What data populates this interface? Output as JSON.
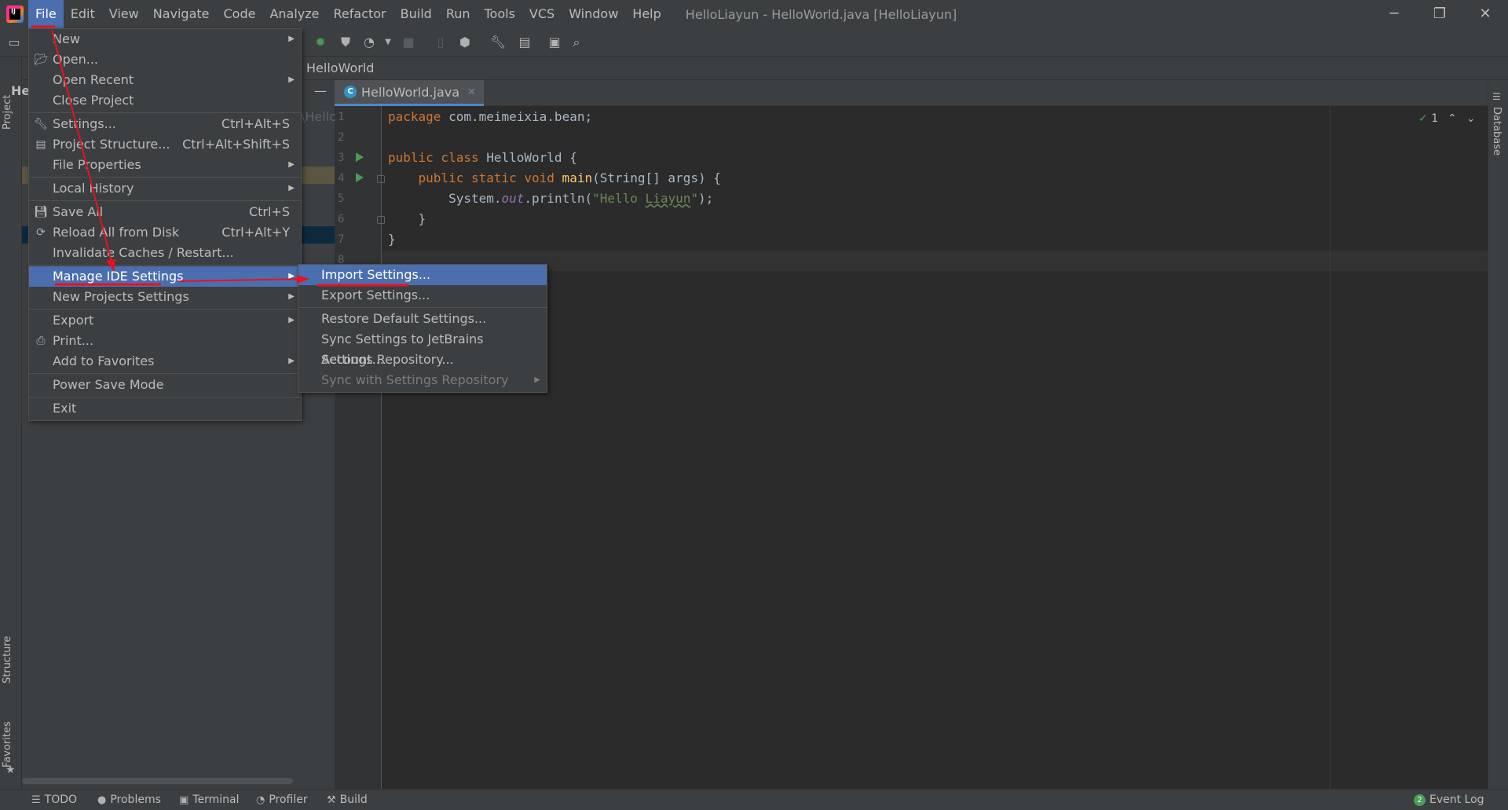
{
  "window": {
    "title": "HelloLiayun - HelloWorld.java [HelloLiayun]",
    "minimize": "─",
    "restore": "❐",
    "close": "✕"
  },
  "menubar": {
    "items": [
      "File",
      "Edit",
      "View",
      "Navigate",
      "Code",
      "Analyze",
      "Refactor",
      "Build",
      "Run",
      "Tools",
      "VCS",
      "Window",
      "Help"
    ]
  },
  "navbar": {
    "breadcrumb": "HelloWorld"
  },
  "project_panel": {
    "header_label": "He",
    "side_tab": "Project"
  },
  "left_strip": {
    "structure_tab": "Structure",
    "favorites_tab": "Favorites"
  },
  "right_strip": {
    "database_tab": "Database"
  },
  "editor": {
    "tab_label": "HelloWorld.java",
    "tab_close": "✕",
    "gutter_partial": "\\Hellc",
    "inspection_count": "1",
    "line_numbers": [
      "1",
      "2",
      "3",
      "4",
      "5",
      "6",
      "7",
      "8"
    ],
    "code": {
      "line1_kw": "package",
      "line1_rest": " com.meimeixia.bean;",
      "line3_kw": "public class",
      "line3_rest": " HelloWorld {",
      "line4_kw": "    public static void",
      "line4_fn": " main",
      "line4_rest": "(String[] args) {",
      "line5_pre": "        System.",
      "line5_out": "out",
      "line5_mid": ".println(",
      "line5_str_a": "\"Hello ",
      "line5_str_b": "Liayun",
      "line5_str_c": "\"",
      "line5_end": ");",
      "line6": "    }",
      "line7": "}"
    }
  },
  "file_menu": {
    "items": [
      {
        "label": "New",
        "shortcut": "",
        "submenu": true
      },
      {
        "label": "Open...",
        "shortcut": "",
        "submenu": false
      },
      {
        "label": "Open Recent",
        "shortcut": "",
        "submenu": true
      },
      {
        "label": "Close Project",
        "shortcut": "",
        "submenu": false
      },
      {
        "label": "Settings...",
        "shortcut": "Ctrl+Alt+S",
        "submenu": false
      },
      {
        "label": "Project Structure...",
        "shortcut": "Ctrl+Alt+Shift+S",
        "submenu": false
      },
      {
        "label": "File Properties",
        "shortcut": "",
        "submenu": true
      },
      {
        "label": "Local History",
        "shortcut": "",
        "submenu": true
      },
      {
        "label": "Save All",
        "shortcut": "Ctrl+S",
        "submenu": false
      },
      {
        "label": "Reload All from Disk",
        "shortcut": "Ctrl+Alt+Y",
        "submenu": false
      },
      {
        "label": "Invalidate Caches / Restart...",
        "shortcut": "",
        "submenu": false
      },
      {
        "label": "Manage IDE Settings",
        "shortcut": "",
        "submenu": true
      },
      {
        "label": "New Projects Settings",
        "shortcut": "",
        "submenu": true
      },
      {
        "label": "Export",
        "shortcut": "",
        "submenu": true
      },
      {
        "label": "Print...",
        "shortcut": "",
        "submenu": false
      },
      {
        "label": "Add to Favorites",
        "shortcut": "",
        "submenu": true
      },
      {
        "label": "Power Save Mode",
        "shortcut": "",
        "submenu": false
      },
      {
        "label": "Exit",
        "shortcut": "",
        "submenu": false
      }
    ]
  },
  "submenu": {
    "items": [
      {
        "label": "Import Settings...",
        "disabled": false
      },
      {
        "label": "Export Settings...",
        "disabled": false
      },
      {
        "label": "Restore Default Settings...",
        "disabled": false
      },
      {
        "label": "Sync Settings to JetBrains Account...",
        "disabled": false
      },
      {
        "label": "Settings Repository...",
        "disabled": false
      },
      {
        "label": "Sync with Settings Repository",
        "disabled": true
      }
    ]
  },
  "statusbar": {
    "todo": "TODO",
    "problems": "Problems",
    "terminal": "Terminal",
    "profiler": "Profiler",
    "build": "Build",
    "event_log": "Event Log",
    "event_count": "2"
  },
  "colors": {
    "accent": "#4b6eaf",
    "annotation": "#e8121e",
    "run_icon": "#499c54"
  }
}
